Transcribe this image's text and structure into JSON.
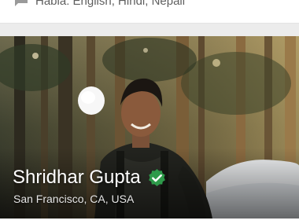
{
  "languages": {
    "icon": "chat-bubble-icon",
    "text": "Habla: English, Hindi, Nepali"
  },
  "host": {
    "name": "Shridhar Gupta",
    "location": "San Francisco, CA, USA",
    "verified_icon": "verified-check-icon",
    "verified_color": "#2e9a4a"
  }
}
